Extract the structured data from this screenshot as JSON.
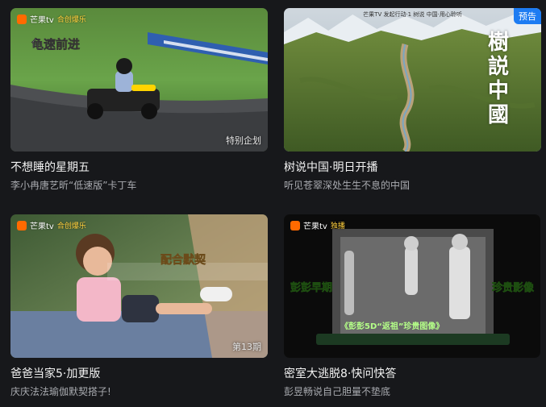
{
  "cards": [
    {
      "title": "不想睡的星期五",
      "subtitle": "李小冉唐艺昕“低速版”卡丁车",
      "logo_text": "芒果tv",
      "logo_sub": "合创爆乐",
      "corner_tag": "特别企划",
      "overlay": [
        "龟速",
        "前进"
      ]
    },
    {
      "title": "树说中国·明日开播",
      "subtitle": "听见苍翠深处生生不息的中国",
      "badge": "预告",
      "overlay_top": "芒果TV 发起行动·1 树说 中国·用心聆听",
      "calligraphy": "樹説中國"
    },
    {
      "title": "爸爸当家5·加更版",
      "subtitle": "庆庆法法瑜伽默契搭子!",
      "logo_text": "芒果tv",
      "logo_sub": "合创爆乐",
      "corner_tag": "第13期",
      "overlay": [
        "配合默契"
      ]
    },
    {
      "title": "密室大逃脱8·快问快答",
      "subtitle": "彭昱畅说自己胆量不垫底",
      "logo_text": "芒果tv",
      "logo_sub": "独播",
      "overlay_left": "彭彭早期",
      "overlay_right": "珍贵影像",
      "overlay_bottom": "《彭彭5D“返祖”珍贵图像》"
    }
  ],
  "colors": {
    "background": "#17181b",
    "title": "#f2f2f2",
    "subtitle": "#a9abb0",
    "badge": "#1d7cf2",
    "logo": "#ff6a00"
  }
}
